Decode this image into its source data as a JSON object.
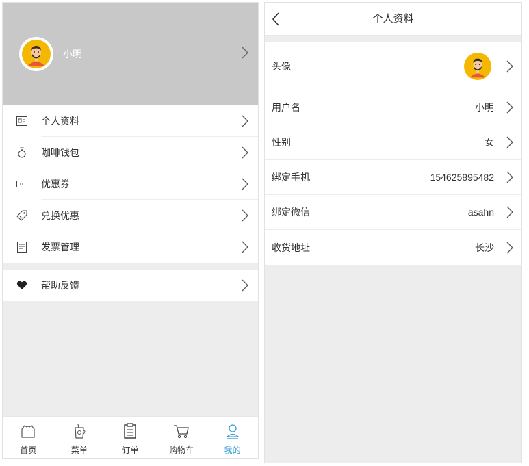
{
  "left": {
    "profile": {
      "name": "小明"
    },
    "menu_group_1": [
      {
        "label": "个人资料",
        "icon": "id-card-icon"
      },
      {
        "label": "咖啡钱包",
        "icon": "wallet-icon"
      },
      {
        "label": "优惠券",
        "icon": "coupon-icon"
      },
      {
        "label": "兑换优惠",
        "icon": "tag-icon"
      },
      {
        "label": "发票管理",
        "icon": "invoice-icon"
      }
    ],
    "menu_group_2": [
      {
        "label": "帮助反馈",
        "icon": "heart-icon"
      }
    ],
    "tabbar": [
      {
        "label": "首页",
        "icon": "home-icon",
        "active": false
      },
      {
        "label": "菜单",
        "icon": "cup-icon",
        "active": false
      },
      {
        "label": "订单",
        "icon": "clipboard-icon",
        "active": false
      },
      {
        "label": "购物车",
        "icon": "cart-icon",
        "active": false
      },
      {
        "label": "我的",
        "icon": "user-icon",
        "active": true
      }
    ]
  },
  "right": {
    "title": "个人资料",
    "rows": [
      {
        "label": "头像",
        "value": ""
      },
      {
        "label": "用户名",
        "value": "小明"
      },
      {
        "label": "性别",
        "value": "女"
      },
      {
        "label": "绑定手机",
        "value": "154625895482"
      },
      {
        "label": "绑定微信",
        "value": "asahn"
      },
      {
        "label": "收货地址",
        "value": "长沙"
      }
    ]
  },
  "colors": {
    "accent": "#3a9ed1",
    "header_gray": "#c8c8c8",
    "background": "#ededed",
    "avatar_bg": "#f5b800"
  }
}
